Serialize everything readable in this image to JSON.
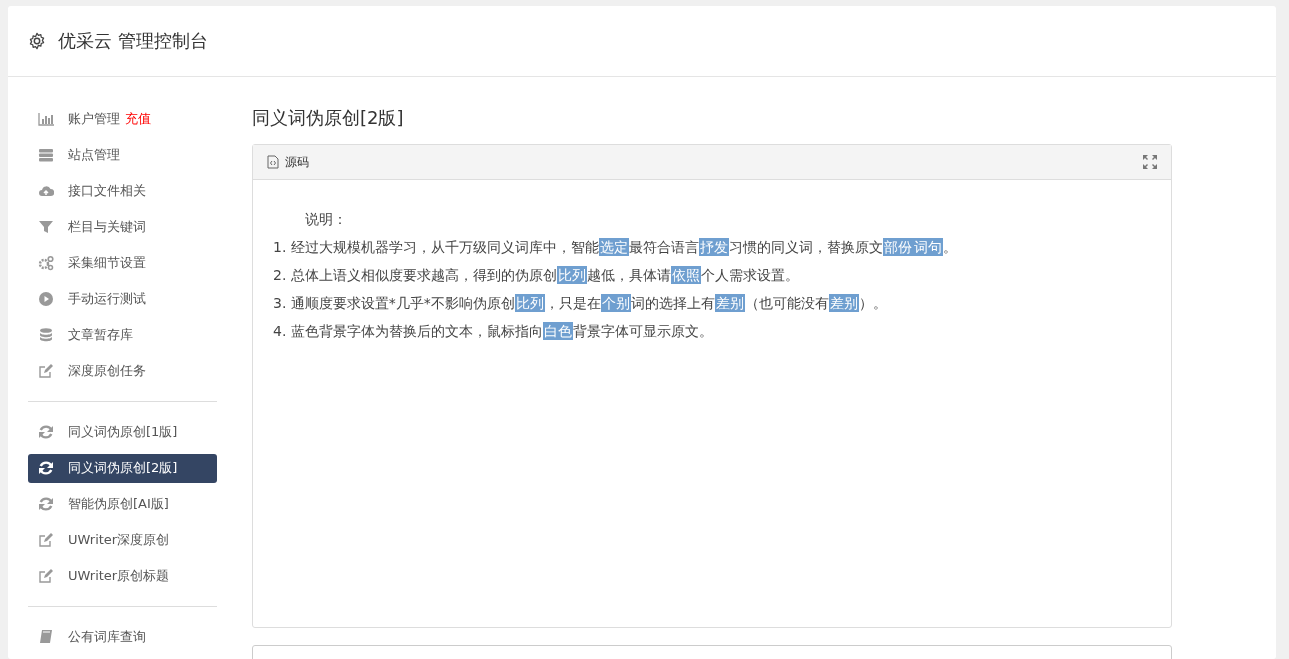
{
  "header": {
    "title": "优采云 管理控制台"
  },
  "sidebar": {
    "groups": [
      {
        "items": [
          {
            "label": "账户管理",
            "badge": "充值",
            "kind": "chart",
            "selected": false
          },
          {
            "label": "站点管理",
            "kind": "server",
            "selected": false
          },
          {
            "label": "接口文件相关",
            "kind": "cloud",
            "selected": false
          },
          {
            "label": "栏目与关键词",
            "kind": "filter",
            "selected": false
          },
          {
            "label": "采集细节设置",
            "kind": "gears",
            "selected": false
          },
          {
            "label": "手动运行测试",
            "kind": "play",
            "selected": false
          },
          {
            "label": "文章暂存库",
            "kind": "database",
            "selected": false
          },
          {
            "label": "深度原创任务",
            "kind": "edit",
            "selected": false
          }
        ]
      },
      {
        "items": [
          {
            "label": "同义词伪原创[1版]",
            "kind": "refresh",
            "selected": false
          },
          {
            "label": "同义词伪原创[2版]",
            "kind": "refresh",
            "selected": true
          },
          {
            "label": "智能伪原创[AI版]",
            "kind": "refresh",
            "selected": false
          },
          {
            "label": "UWriter深度原创",
            "kind": "edit",
            "selected": false
          },
          {
            "label": "UWriter原创标题",
            "kind": "edit",
            "selected": false
          }
        ]
      },
      {
        "items": [
          {
            "label": "公有词库查询",
            "kind": "book",
            "selected": false
          }
        ]
      }
    ]
  },
  "main": {
    "title": "同义词伪原创[2版]",
    "editor": {
      "tab": "源码",
      "intro": "说明：",
      "lines": [
        [
          {
            "text": "1. 经过大规模机器学习，从千万级同义词库中，智能",
            "replaced": false
          },
          {
            "text": "选定",
            "replaced": true
          },
          {
            "text": "最符合语言",
            "replaced": false
          },
          {
            "text": "抒发",
            "replaced": true
          },
          {
            "text": "习惯的同义词，替换原文",
            "replaced": false
          },
          {
            "text": "部份",
            "replaced": true
          },
          {
            "text": "词句",
            "replaced": true
          },
          {
            "text": "。",
            "replaced": false
          }
        ],
        [
          {
            "text": "2. 总体上语义相似度要求越高，得到的伪原创",
            "replaced": false
          },
          {
            "text": "比列",
            "replaced": true
          },
          {
            "text": "越低，具体请",
            "replaced": false
          },
          {
            "text": "依照",
            "replaced": true
          },
          {
            "text": "个人需求设置。",
            "replaced": false
          }
        ],
        [
          {
            "text": "3. 通顺度要求设置*几乎*不影响伪原创",
            "replaced": false
          },
          {
            "text": "比列",
            "replaced": true
          },
          {
            "text": "，只是在",
            "replaced": false
          },
          {
            "text": "个别",
            "replaced": true
          },
          {
            "text": "词的选择上有",
            "replaced": false
          },
          {
            "text": "差别",
            "replaced": true
          },
          {
            "text": "（也可能没有",
            "replaced": false
          },
          {
            "text": "差别",
            "replaced": true
          },
          {
            "text": "）。",
            "replaced": false
          }
        ],
        [
          {
            "text": "4. 蓝色背景字体为替换后的文本，鼠标指向",
            "replaced": false
          },
          {
            "text": "白色",
            "replaced": true
          },
          {
            "text": "背景字体可显示原文。",
            "replaced": false
          }
        ]
      ]
    }
  }
}
